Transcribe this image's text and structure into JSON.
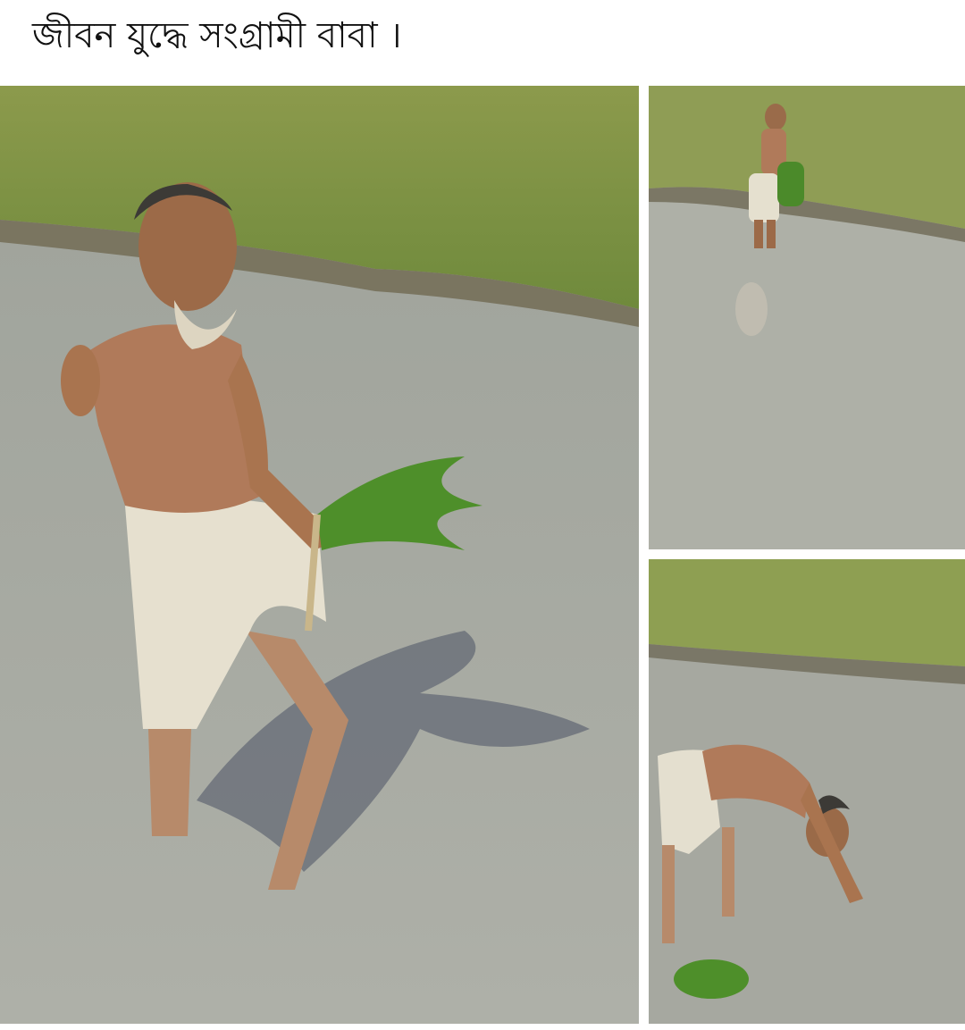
{
  "post": {
    "caption": "জীবন যুদ্ধে সংগ্রামী বাবা ।"
  },
  "images": [
    {
      "role": "main",
      "subject": "farmer-holding-rice-seedlings"
    },
    {
      "role": "top-right",
      "subject": "farmer-distant-in-field"
    },
    {
      "role": "bottom-right",
      "subject": "farmer-bending-planting"
    }
  ],
  "colors": {
    "background": "#ffffff",
    "grass": "#8aa24a",
    "water": "#a3a69d",
    "skin": "#b07a5a",
    "cloth": "#e2ddcc"
  }
}
